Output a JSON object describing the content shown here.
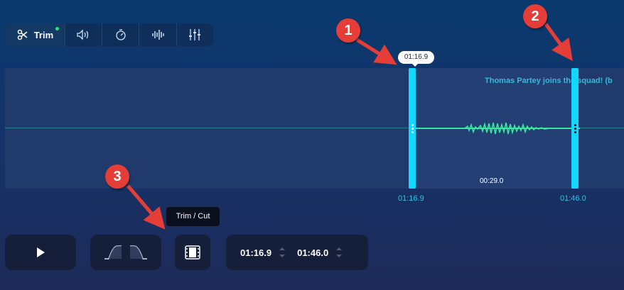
{
  "toolbar": {
    "trim_label": "Trim",
    "icons": [
      "scissors-icon",
      "volume-icon",
      "speed-icon",
      "waveform-icon",
      "equalizer-icon"
    ],
    "active_dot_color": "#2ee07a"
  },
  "editor": {
    "banner_text": "Thomas Partey joins the squad! (b",
    "selection_duration": "00:29.0",
    "start_bubble": "01:16.9",
    "start_label": "01:16.9",
    "end_label": "01:46.0",
    "handle_color": "#12d8ff",
    "wave_color": "#38e6a0"
  },
  "controls": {
    "tooltip": "Trim / Cut",
    "start_time": "01:16.9",
    "end_time": "01:46.0"
  },
  "annotations": [
    "1",
    "2",
    "3"
  ],
  "annotation_color": "#e53d38"
}
